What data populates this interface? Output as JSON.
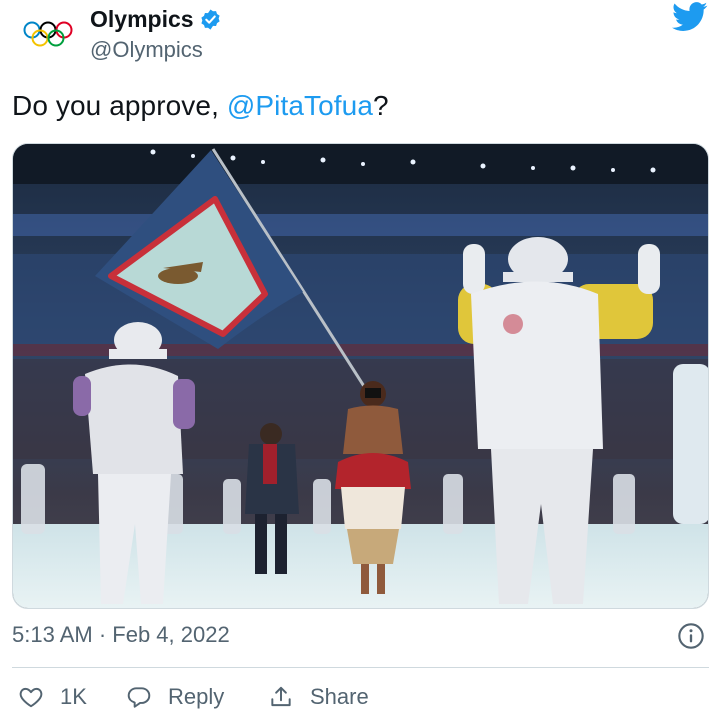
{
  "colors": {
    "accent": "#1d9bf0",
    "text": "#0f1419",
    "muted": "#536471",
    "border": "#cfd9de"
  },
  "header": {
    "display_name": "Olympics",
    "handle": "@Olympics",
    "verified": true,
    "logo_icon": "olympic-rings-icon",
    "platform_icon": "twitter-bird-icon"
  },
  "tweet": {
    "text_prefix": "Do you approve, ",
    "mention": "@PitaTofua",
    "text_suffix": "?",
    "media_description_icon": "photo-flagbearer"
  },
  "meta": {
    "timestamp": "5:13 AM · Feb 4, 2022",
    "info_icon": "info-icon"
  },
  "actions": {
    "like_count": "1K",
    "reply_label": "Reply",
    "share_label": "Share"
  }
}
